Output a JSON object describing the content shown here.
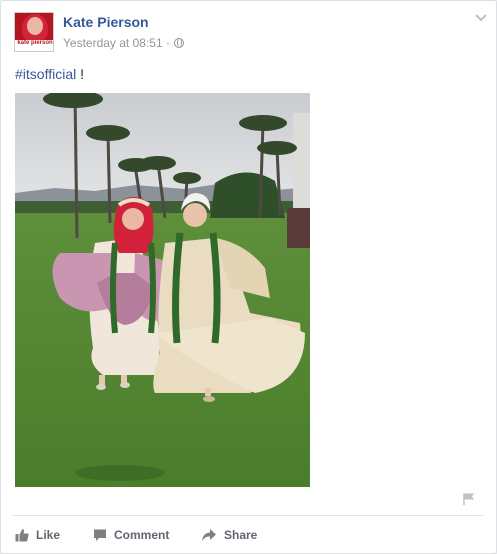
{
  "post": {
    "author": "Kate Pierson",
    "avatar_caption": "kate pierson",
    "timestamp": "Yesterday at 08:51",
    "separator": "·",
    "audience_icon": "globe-icon",
    "hashtag": "#itsofficial",
    "text_suffix": " !",
    "photo_icon": "photo"
  },
  "actions": {
    "like_label": "Like",
    "comment_label": "Comment",
    "share_label": "Share"
  },
  "colors": {
    "link": "#365899",
    "meta": "#90949c",
    "action": "#616770"
  }
}
